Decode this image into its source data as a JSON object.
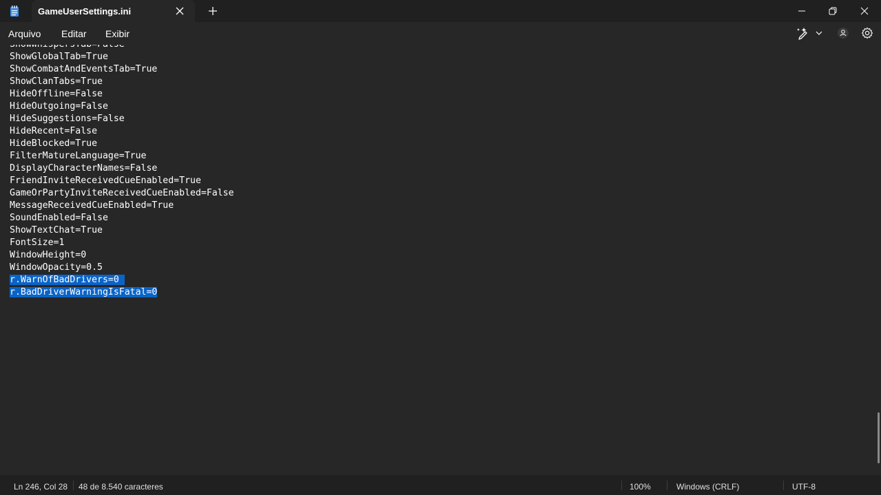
{
  "window": {
    "tab_title": "GameUserSettings.ini"
  },
  "menu": {
    "items": [
      "Arquivo",
      "Editar",
      "Exibir"
    ]
  },
  "editor": {
    "lines": [
      "ShowWhispersTab=False",
      "ShowGlobalTab=True",
      "ShowCombatAndEventsTab=True",
      "ShowClanTabs=True",
      "HideOffline=False",
      "HideOutgoing=False",
      "HideSuggestions=False",
      "HideRecent=False",
      "HideBlocked=True",
      "FilterMatureLanguage=True",
      "DisplayCharacterNames=False",
      "FriendInviteReceivedCueEnabled=True",
      "GameOrPartyInviteReceivedCueEnabled=False",
      "MessageReceivedCueEnabled=True",
      "SoundEnabled=False",
      "ShowTextChat=True",
      "FontSize=1",
      "WindowHeight=0",
      "WindowOpacity=0.5",
      "r.WarnOfBadDrivers=0 ",
      "r.BadDriverWarningIsFatal=0"
    ],
    "selected_lines": [
      19,
      20
    ],
    "selection_color": "#0a64c8"
  },
  "status": {
    "position": "Ln 246, Col 28",
    "char_count": "48 de 8.540 caracteres",
    "zoom": "100%",
    "line_ending": "Windows (CRLF)",
    "encoding": "UTF-8"
  },
  "icons": {
    "app": "notepad-icon",
    "tab_close": "close-icon",
    "new_tab": "plus-icon",
    "minimize": "minimize-icon",
    "maximize": "restore-icon",
    "close": "close-icon",
    "copilot": "sparkle-pen-icon",
    "dropdown": "chevron-down-icon",
    "account": "account-icon",
    "settings": "gear-icon"
  }
}
